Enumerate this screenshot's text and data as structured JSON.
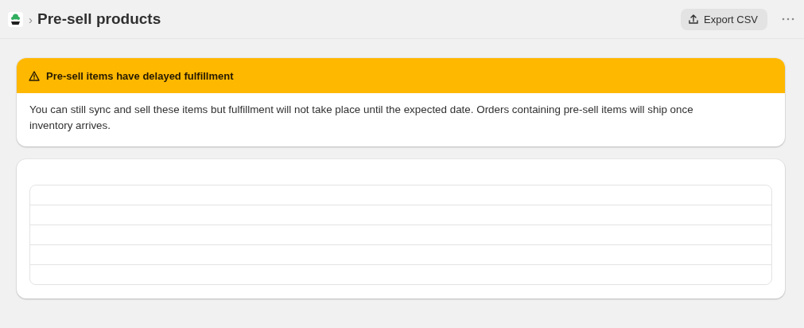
{
  "header": {
    "breadcrumb_separator": "›",
    "title": "Pre-sell products",
    "actions": [
      {
        "label": "Export CSV"
      }
    ]
  },
  "banner": {
    "kind": "warning",
    "title": "Pre-sell items have delayed fulfillment",
    "message": "You can still sync and sell these items but fulfillment will not take place until the expected date. Orders containing pre-sell items will ship once inventory arrives."
  }
}
